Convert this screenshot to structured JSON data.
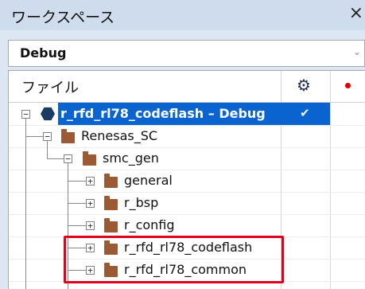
{
  "panel": {
    "title": "ワークスペース",
    "close_label": "×"
  },
  "config": {
    "selected": "Debug",
    "arrow": "⌄"
  },
  "tree_header": {
    "file_label": "ファイル",
    "gear_icon": "gear-icon",
    "dot_color": "#e00000"
  },
  "project": {
    "label": "r_rfd_rl78_codeflash – Debug",
    "check": "✔",
    "expander": "−"
  },
  "items": [
    {
      "label": "Renesas_SC",
      "expander": "−"
    },
    {
      "label": "smc_gen",
      "expander": "−"
    },
    {
      "label": "general",
      "expander": "+"
    },
    {
      "label": "r_bsp",
      "expander": "+"
    },
    {
      "label": "r_config",
      "expander": "+"
    },
    {
      "label": "r_rfd_rl78_codeflash",
      "expander": "+"
    },
    {
      "label": "r_rfd_rl78_common",
      "expander": "+"
    }
  ],
  "colors": {
    "selection": "#0a64d0",
    "folder": "#9c5a34",
    "highlight_box": "#e0001b"
  }
}
